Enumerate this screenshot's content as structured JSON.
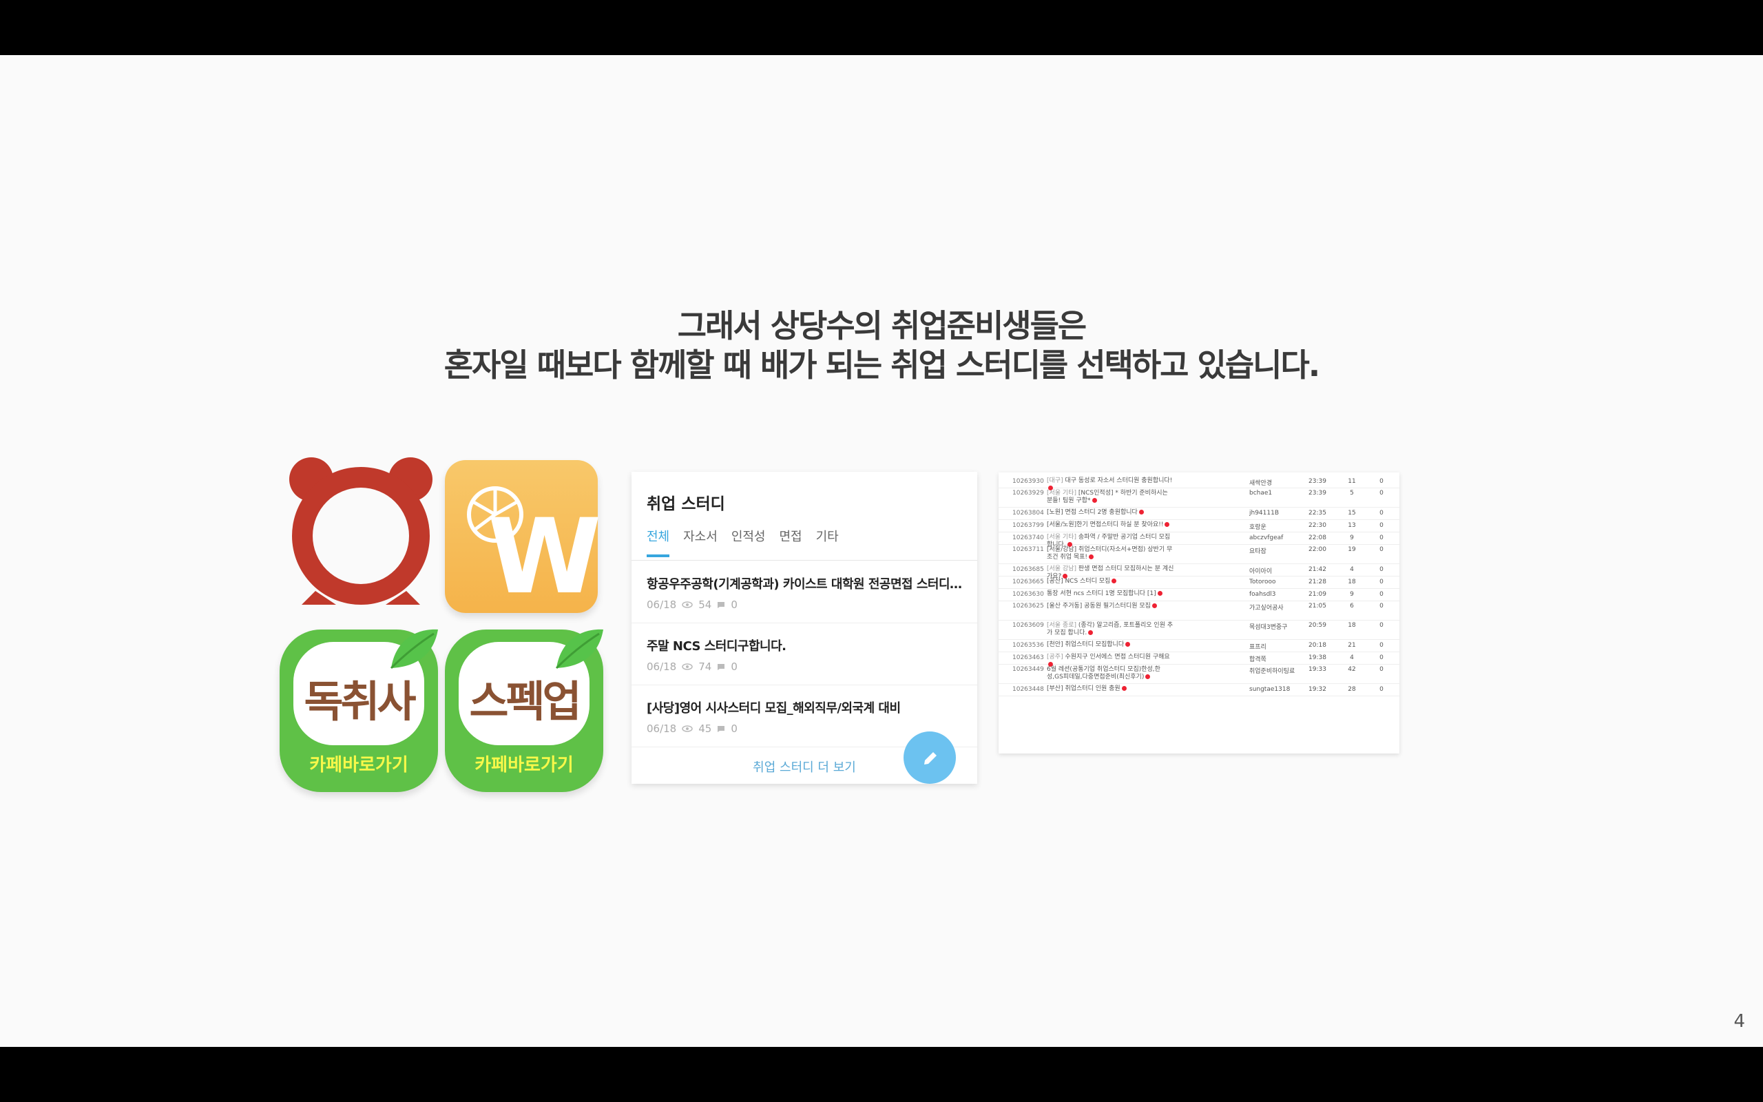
{
  "headline": {
    "line1": "그래서 상당수의 취업준비생들은",
    "line2": "혼자일 때보다 함께할 때 배가 되는 취업 스터디를 선택하고 있습니다."
  },
  "page_number": "4",
  "icons": {
    "w_tile_letter": "W",
    "green_tiles": [
      {
        "name": "독취사",
        "cafe": "카페바로가기"
      },
      {
        "name": "스펙업",
        "cafe": "카페바로가기"
      }
    ]
  },
  "card": {
    "title": "취업 스터디",
    "tabs": [
      "전체",
      "자소서",
      "인적성",
      "면접",
      "기타"
    ],
    "posts": [
      {
        "title": "항공우주공학(기계공학과) 카이스트 대학원 전공면접 스터디 구…",
        "date": "06/18",
        "views": "54",
        "comments": "0"
      },
      {
        "title": "주말 NCS 스터디구합니다.",
        "date": "06/18",
        "views": "74",
        "comments": "0"
      },
      {
        "title": "[사당]영어 시사스터디 모집_해외직무/외국계 대비",
        "date": "06/18",
        "views": "45",
        "comments": "0"
      }
    ],
    "more_label": "취업 스터디 더 보기"
  },
  "table": {
    "rows": [
      {
        "id": "10263930",
        "cat": "[대구]",
        "title": "대구 동성로 자소서 스터디원 충원합니다!",
        "user": "새싹안경",
        "time": "23:39",
        "views": "11",
        "comments": "0"
      },
      {
        "id": "10263929",
        "cat": "[서울 기타]",
        "title": "[NCS인적성] * 하반기 준비하시는 분들! 팀원 구합*",
        "user": "bchae1",
        "time": "23:39",
        "views": "5",
        "comments": "0"
      },
      {
        "id": "10263804",
        "cat": "",
        "title": "[노원] 면접 스터디 2명 충원합니다",
        "user": "jh94111B",
        "time": "22:35",
        "views": "15",
        "comments": "0"
      },
      {
        "id": "10263799",
        "cat": "",
        "title": "[서울/노원]한기 면접스터디 하실 분 찾아요!!",
        "user": "호랑운",
        "time": "22:30",
        "views": "13",
        "comments": "0"
      },
      {
        "id": "10263740",
        "cat": "[서울 기타]",
        "title": "송파역 / 주말반 공기업 스터디 모집합니다.",
        "user": "abczvfgeaf",
        "time": "22:08",
        "views": "9",
        "comments": "0"
      },
      {
        "id": "10263711",
        "cat": "",
        "title": "[서울/강남] 취업스터디(자소서+면접) 상반기 무조건 취업 목표!",
        "user": "요타잠",
        "time": "22:00",
        "views": "19",
        "comments": "0"
      },
      {
        "id": "10263685",
        "cat": "[서울 강남]",
        "title": "판생 면접 스터디 모집하시는 분 계신가요?",
        "user": "아이아이",
        "time": "21:42",
        "views": "4",
        "comments": "0"
      },
      {
        "id": "10263665",
        "cat": "",
        "title": "[공산] NCS 스터디 모집",
        "user": "Totorooo",
        "time": "21:28",
        "views": "18",
        "comments": "0"
      },
      {
        "id": "10263630",
        "cat": "",
        "title": "통장 서현 ncs 스터디 1명 모집합니다 [1]",
        "user": "foahsdl3",
        "time": "21:09",
        "views": "9",
        "comments": "0"
      },
      {
        "id": "10263625",
        "cat": "",
        "title": "[울산 주거동] 공동원 필기스터디원 모집",
        "user": "가고싶어공사",
        "time": "21:05",
        "views": "6",
        "comments": "0"
      },
      {
        "id": "10263609",
        "cat": "[서울 종로]",
        "title": "(종각) 알고리즘, 포트폴리오 인원 추가 모집 합니다.",
        "user": "목섬대3변중구",
        "time": "20:59",
        "views": "18",
        "comments": "0"
      },
      {
        "id": "10263536",
        "cat": "",
        "title": "[천안] 취업스터디 모집합니다",
        "user": "표프리",
        "time": "20:18",
        "views": "21",
        "comments": "0"
      },
      {
        "id": "10263463",
        "cat": "[공주]",
        "title": "수원지구 인서에스 면접 스터디원 구해요",
        "user": "합격쪽",
        "time": "19:38",
        "views": "4",
        "comments": "0"
      },
      {
        "id": "10263449",
        "cat": "",
        "title": "6월 레션(공통기업 취업스터디 모집)한성,한성,GS피데일,다중면접준비(최신후기)",
        "user": "취업준비하이팅료",
        "time": "19:33",
        "views": "42",
        "comments": "0"
      },
      {
        "id": "10263448",
        "cat": "",
        "title": "[부산] 취업스터디 인원 충원",
        "user": "sungtae1318",
        "time": "19:32",
        "views": "28",
        "comments": "0"
      }
    ]
  },
  "colors": {
    "accent_blue": "#37a6de",
    "fab_blue": "#6cc2f0",
    "alarm_red": "#c0392b",
    "w_orange": "#f5b34a",
    "green": "#5fc147",
    "leaf_green": "#56c34a",
    "tile_text_brown": "#8a5233",
    "cafe_yellow": "#f7f84a"
  }
}
